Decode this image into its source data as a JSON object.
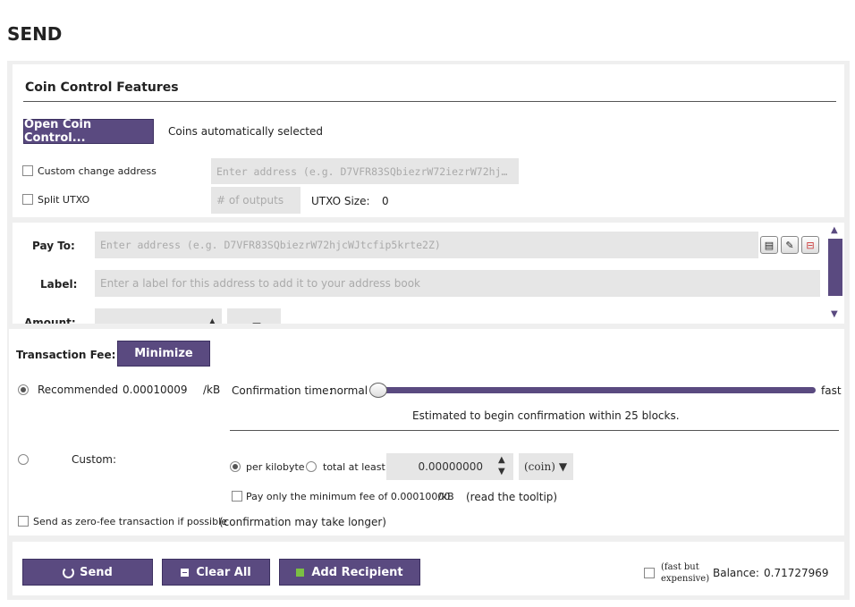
{
  "page_title": "SEND",
  "coin_control": {
    "heading": "Coin Control Features",
    "open_button": "Open Coin Control...",
    "status": "Coins automatically selected",
    "custom_change_label": "Custom change address",
    "custom_change_placeholder": "Enter address (e.g. D7VFR83SQbiezrW72iezrW72hj…",
    "split_utxo_label": "Split UTXO",
    "outputs_placeholder": "# of outputs",
    "utxo_size_label": "UTXO Size:",
    "utxo_size_value": "0"
  },
  "recipient": {
    "pay_to_label": "Pay To:",
    "pay_to_placeholder": "Enter address (e.g. D7VFR83SQbiezrW72hjcWJtcfip5krte2Z)",
    "label_label": "Label:",
    "label_placeholder": "Enter a label for this address to add it to your address book",
    "amount_label": "Amount:"
  },
  "fee": {
    "label": "Transaction Fee:",
    "minimize_button": "Minimize",
    "recommended_label": "Recommended",
    "recommended_value": "0.00010009",
    "recommended_unit": "/kB",
    "confirmation_label": "Confirmation time:",
    "slider_left": "normal",
    "slider_right": "fast",
    "slider_level": 0.0,
    "estimate_text": "Estimated to begin confirmation within 25 blocks.",
    "custom_label": "Custom:",
    "per_kilobyte_label": "per kilobyte",
    "total_at_least_label": "total at least",
    "custom_amount": "0.00000000",
    "unit_select": "(coin)",
    "min_fee_label": "Pay only the minimum fee of 0.00010000",
    "min_fee_unit": "/kB",
    "tooltip_hint": "(read the tooltip)",
    "zero_fee_label": "Send as zero-fee transaction if possible",
    "zero_fee_note": "(confirmation may take longer)"
  },
  "actions": {
    "send_button": "Send",
    "clear_all_button": "Clear All",
    "add_recipient_button": "Add Recipient",
    "fast_label_line1": "(fast but",
    "fast_label_line2": "expensive)",
    "balance_label": "Balance:",
    "balance_value": "0.71727969"
  },
  "colors": {
    "accent": "#5a4a80",
    "field_bg": "#e6e6e6",
    "panel_bg": "#efefef"
  }
}
